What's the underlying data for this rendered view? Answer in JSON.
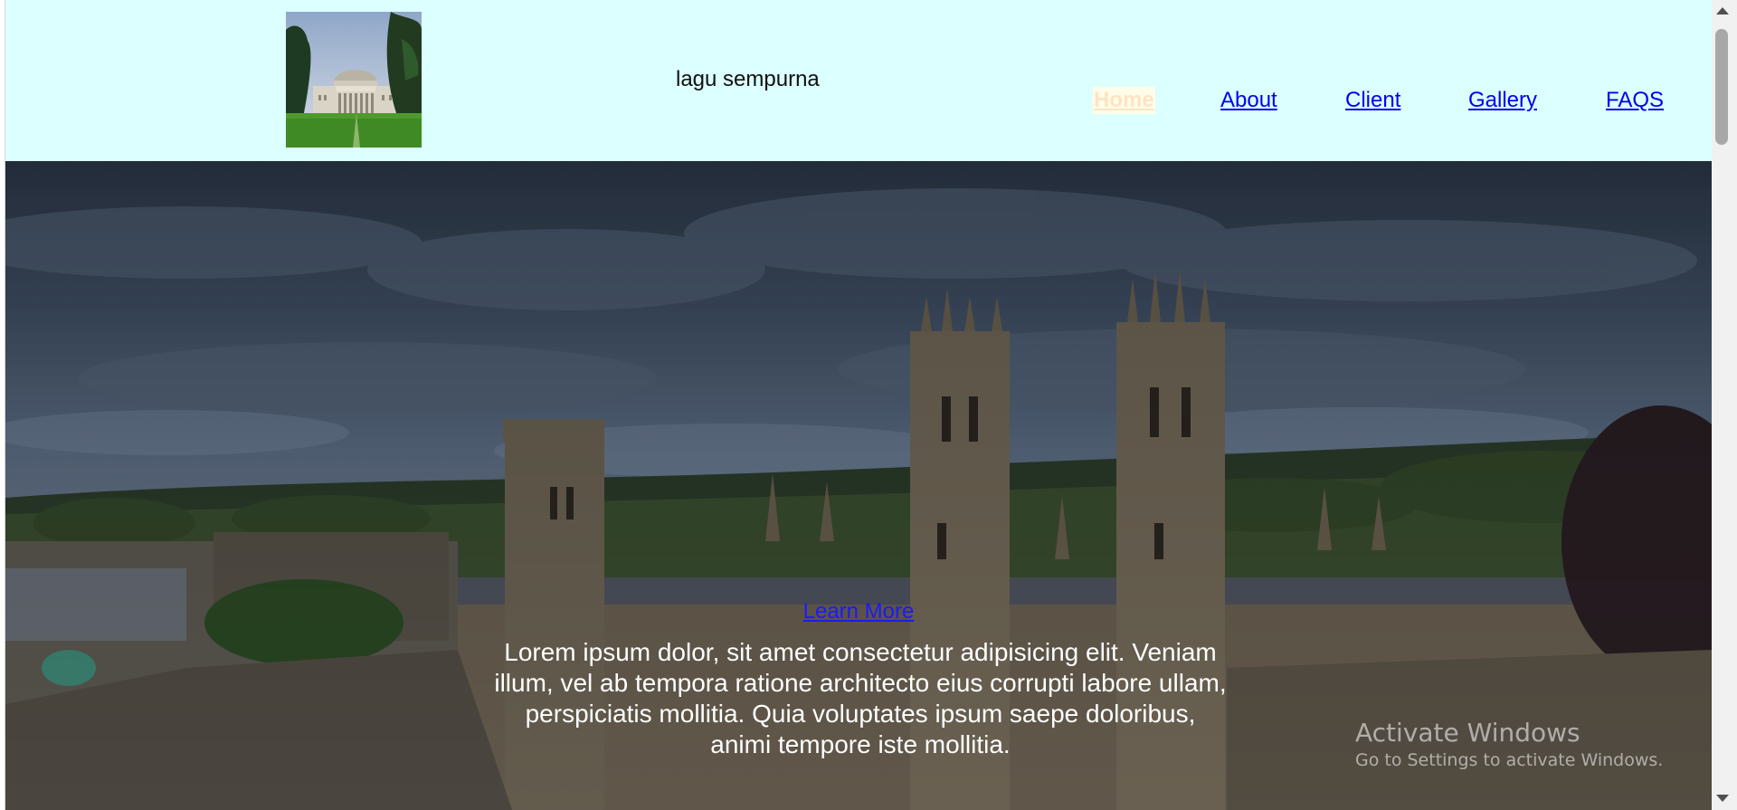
{
  "header": {
    "site_title": "lagu sempurna",
    "logo_icon": "university-building-logo"
  },
  "nav": {
    "items": [
      {
        "label": "Home",
        "active": true
      },
      {
        "label": "About",
        "active": false
      },
      {
        "label": "Client",
        "active": false
      },
      {
        "label": "Gallery",
        "active": false
      },
      {
        "label": "FAQS",
        "active": false
      }
    ]
  },
  "hero": {
    "text": "Lorem ipsum dolor, sit amet consectetur adipisicing elit. Veniam illum, vel ab tempora ratione architecto eius corrupti labore ullam, perspiciatis mollitia. Quia voluptates ipsum saepe doloribus, animi tempore iste mollitia.",
    "learn_more_label": "Learn More",
    "background": "university-campus-skyline-photo"
  },
  "os_overlay": {
    "title": "Activate Windows",
    "subtitle": "Go to Settings to activate Windows."
  },
  "colors": {
    "header_bg": "#dcffff",
    "link": "#0000ee",
    "active_link": "#ffe3c3"
  }
}
